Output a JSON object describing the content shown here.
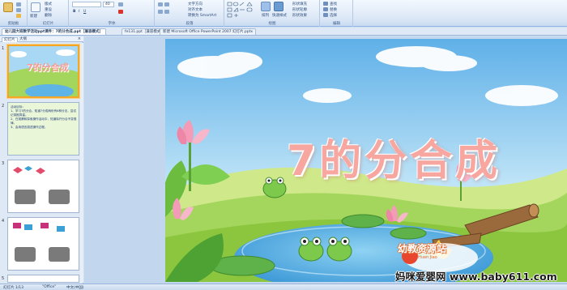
{
  "ribbon": {
    "groups": [
      {
        "label": "剪贴板"
      },
      {
        "label": "幻灯片"
      },
      {
        "label": "字体"
      },
      {
        "label": "段落"
      },
      {
        "label": "绘图"
      },
      {
        "label": "编辑"
      }
    ],
    "new_slide": "新建",
    "layout": "版式",
    "reset": "重设",
    "delete": "删除",
    "font_name": "",
    "font_size": "40",
    "text_direction": "文字方向",
    "align_text": "对齐文本",
    "convert_smartart": "转换为 SmartArt",
    "arrange": "排列",
    "quick_styles": "快速样式",
    "shape_fill": "形状填充",
    "shape_outline": "形状轮廓",
    "shape_effects": "形状效果",
    "find": "查找",
    "replace": "替换",
    "select": "选择"
  },
  "tabs": [
    "幼儿园大班数学活动ppt课件：7的分合成.ppt［兼容模式］",
    "fe131.ppt［兼容模式］",
    "新建 Microsoft Office PowerPoint 2007 幻灯片.pptx"
  ],
  "left_panel": {
    "tab_slides": "幻灯片",
    "tab_outline": "大纲",
    "close": "×",
    "slides": [
      {
        "num": "1",
        "text": "7的分合成"
      },
      {
        "num": "2",
        "text": "活动目标：\n1、学习7的分合，知道7分成两份有6种分法，尝试记录推算量。\n2、在观察和探索操作活动中，知道除开分合不变规律。\n3、会用语言描述操作过程。"
      },
      {
        "num": "3",
        "text": ""
      },
      {
        "num": "4",
        "text": ""
      },
      {
        "num": "5",
        "text": ""
      }
    ]
  },
  "slide": {
    "title": "7的分合成",
    "logo_text": "幼教资源站",
    "logo_sub": "Huan Jiao"
  },
  "statusbar": {
    "slide_info": "幻灯片 1/13",
    "theme": "\"Office\"",
    "lang": "中文(中国)"
  },
  "watermark": "妈咪爱婴网 www.baby611.com",
  "colors": {
    "title_pink": "#f7a7a0",
    "sky": "#a9d8f5",
    "grass": "#8cc63e",
    "water": "#5fb4e6",
    "selection": "#f5a623"
  }
}
